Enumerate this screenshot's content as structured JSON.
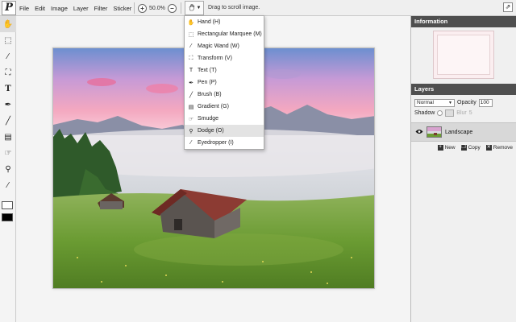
{
  "app": {
    "logo_letter": "P"
  },
  "menu": [
    "File",
    "Edit",
    "Image",
    "Layer",
    "Filter",
    "Sticker"
  ],
  "zoom": {
    "value": "50.0%",
    "zoom_in_label": "+",
    "zoom_out_label": "−"
  },
  "tool_hint": "Drag to scroll image.",
  "dropdown_items": [
    {
      "label": "Hand (H)",
      "icon": "hand-icon",
      "glyph": "✋"
    },
    {
      "label": "Rectangular Marquee (M)",
      "icon": "marquee-icon",
      "glyph": "⬚"
    },
    {
      "label": "Magic Wand (W)",
      "icon": "magic-wand-icon",
      "glyph": "⁄"
    },
    {
      "label": "Transform (V)",
      "icon": "transform-icon",
      "glyph": "⛶"
    },
    {
      "label": "Text (T)",
      "icon": "text-icon",
      "glyph": "T"
    },
    {
      "label": "Pen (P)",
      "icon": "pen-icon",
      "glyph": "✒"
    },
    {
      "label": "Brush (B)",
      "icon": "brush-icon",
      "glyph": "╱"
    },
    {
      "label": "Gradient (G)",
      "icon": "gradient-icon",
      "glyph": "▤"
    },
    {
      "label": "Smudge",
      "icon": "smudge-icon",
      "glyph": "☞"
    },
    {
      "label": "Dodge (O)",
      "icon": "dodge-icon",
      "glyph": "⚲"
    },
    {
      "label": "Eyedropper (I)",
      "icon": "eyedropper-icon",
      "glyph": "⁄"
    }
  ],
  "dropdown_highlighted": "Dodge (O)",
  "info_panel": {
    "title": "Information"
  },
  "layers_panel": {
    "title": "Layers",
    "blend_mode": "Normal",
    "opacity_label": "Opacity",
    "opacity_value": "100",
    "shadow_label": "Shadow",
    "blur_label": "Blur",
    "blur_value": "5",
    "layer_name": "Landscape",
    "actions": {
      "new": "New",
      "copy": "Copy",
      "remove": "Remove"
    }
  },
  "colors": {
    "accent_header": "#4f4f4f",
    "highlight": "#e3e3e3"
  }
}
